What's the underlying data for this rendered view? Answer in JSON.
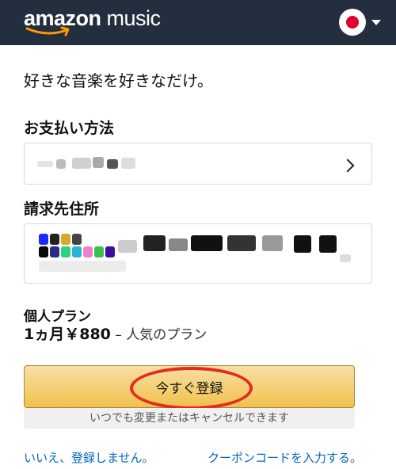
{
  "header": {
    "logo_text_bold": "amazon",
    "logo_text_light": " music",
    "country_flag_icon": "japan-flag-icon",
    "dropdown_icon": "caret-down-icon",
    "brand_background": "#232f3e"
  },
  "main": {
    "tagline": "好きな音楽を好きなだけ。",
    "payment_method": {
      "title": "お支払い方法",
      "value_redacted": true,
      "chevron_icon": "chevron-right-icon"
    },
    "billing_address": {
      "title": "請求先住所",
      "value_redacted": true
    },
    "plan": {
      "name": "個人プラン",
      "price": "1ヵ月￥880",
      "note": " – 人気のプラン"
    },
    "subscribe_button": {
      "label": "今すぐ登録",
      "accent": "#f0c14b",
      "highlight_ring_color": "#e42b1e"
    },
    "cancel_note": "いつでも変更またはキャンセルできます",
    "links": {
      "decline": "いいえ、登録しません。",
      "coupon": "クーポンコードを入力する。",
      "link_color": "#0066c0"
    }
  }
}
